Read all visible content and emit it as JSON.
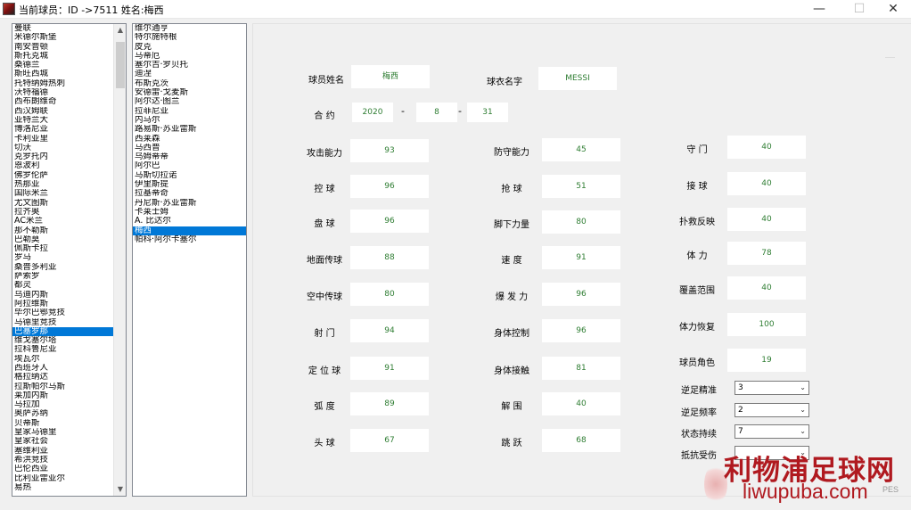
{
  "window": {
    "title": "当前球员：ID ->7511 姓名:梅西",
    "minimize": "—",
    "maximize": "☐",
    "close": "✕"
  },
  "teams": {
    "items": [
      "曼联",
      "米德尔斯堡",
      "南安普顿",
      "斯托克城",
      "桑德兰",
      "斯旺西城",
      "托特纳姆热刺",
      "沃特福德",
      "西布朗维奇",
      "西汉姆联",
      "亚特兰大",
      "博洛尼亚",
      "卡利亚里",
      "切沃",
      "克罗托内",
      "恩波利",
      "佛罗伦萨",
      "热那亚",
      "国际米兰",
      "尤文图斯",
      "拉齐奥",
      "AC米兰",
      "那不勒斯",
      "巴勒莫",
      "佩斯卡拉",
      "罗马",
      "桑普多利亚",
      "萨索罗",
      "都灵",
      "乌迪内斯",
      "阿拉维斯",
      "毕尔巴鄂竞技",
      "马德里竞技",
      "巴塞罗那",
      "维戈塞尔塔",
      "拉科鲁尼亚",
      "埃瓦尔",
      "西班牙人",
      "格拉纳达",
      "拉斯帕尔马斯",
      "莱加内斯",
      "马拉加",
      "奥萨苏纳",
      "贝蒂斯",
      "皇家马德里",
      "皇家社会",
      "塞维利亚",
      "希洪竞技",
      "巴伦西亚",
      "比利亚雷亚尔",
      "易热"
    ],
    "selected_index": 33
  },
  "players": {
    "items": [
      "维尔通亨",
      "特尔施特根",
      "皮克",
      "马蒂厄",
      "塞尔吉·罗贝托",
      "迪涅",
      "布斯克茨",
      "安德雷·戈麦斯",
      "阿尔达·图兰",
      "拉菲尼亚",
      "内马尔",
      "路易斯·苏亚雷斯",
      "西莱森",
      "马西普",
      "乌姆蒂蒂",
      "阿尔巴",
      "马斯切拉诺",
      "伊里斯提",
      "拉基蒂奇",
      "丹尼斯·苏亚雷斯",
      "卡莱士姆",
      "A. 比达尔",
      "梅西",
      "帕科·阿尔卡塞尔"
    ],
    "selected_index": 22
  },
  "profile": {
    "name_label": "球员姓名",
    "name_value": "梅西",
    "jersey_label": "球衣名字",
    "jersey_value": "MESSI",
    "contract_label": "合  约",
    "contract_year": "2020",
    "contract_month": "8",
    "contract_day": "31",
    "dash": "-"
  },
  "stats_col1": [
    {
      "label": "攻击能力",
      "value": "93"
    },
    {
      "label": "控    球",
      "value": "96"
    },
    {
      "label": "盘    球",
      "value": "96"
    },
    {
      "label": "地面传球",
      "value": "88"
    },
    {
      "label": "空中传球",
      "value": "80"
    },
    {
      "label": "射    门",
      "value": "94"
    },
    {
      "label": "定 位 球",
      "value": "91"
    },
    {
      "label": "弧    度",
      "value": "89"
    },
    {
      "label": "头    球",
      "value": "67"
    }
  ],
  "stats_col2": [
    {
      "label": "防守能力",
      "value": "45"
    },
    {
      "label": "抢    球",
      "value": "51"
    },
    {
      "label": "脚下力量",
      "value": "80"
    },
    {
      "label": "速    度",
      "value": "91"
    },
    {
      "label": "爆 发 力",
      "value": "96"
    },
    {
      "label": "身体控制",
      "value": "96"
    },
    {
      "label": "身体接触",
      "value": "81"
    },
    {
      "label": "解    围",
      "value": "40"
    },
    {
      "label": "跳    跃",
      "value": "68"
    }
  ],
  "stats_col3": [
    {
      "label": "守    门",
      "value": "40"
    },
    {
      "label": "接    球",
      "value": "40"
    },
    {
      "label": "扑救反映",
      "value": "40"
    },
    {
      "label": "体    力",
      "value": "78"
    },
    {
      "label": "覆盖范围",
      "value": "40"
    },
    {
      "label": "体力恢复",
      "value": "100"
    },
    {
      "label": "球员角色",
      "value": "19"
    }
  ],
  "selects": [
    {
      "label": "逆足精准",
      "value": "3"
    },
    {
      "label": "逆足频率",
      "value": "2"
    },
    {
      "label": "状态持续",
      "value": "7"
    },
    {
      "label": "抵抗受伤",
      "value": ""
    }
  ],
  "watermark": {
    "cn": "利物浦足球网",
    "en": "liwupuba.com",
    "pes": "PES"
  },
  "colors": {
    "value_text": "#2e7d32",
    "selection": "#0078d7",
    "watermark": "#b0191f"
  }
}
